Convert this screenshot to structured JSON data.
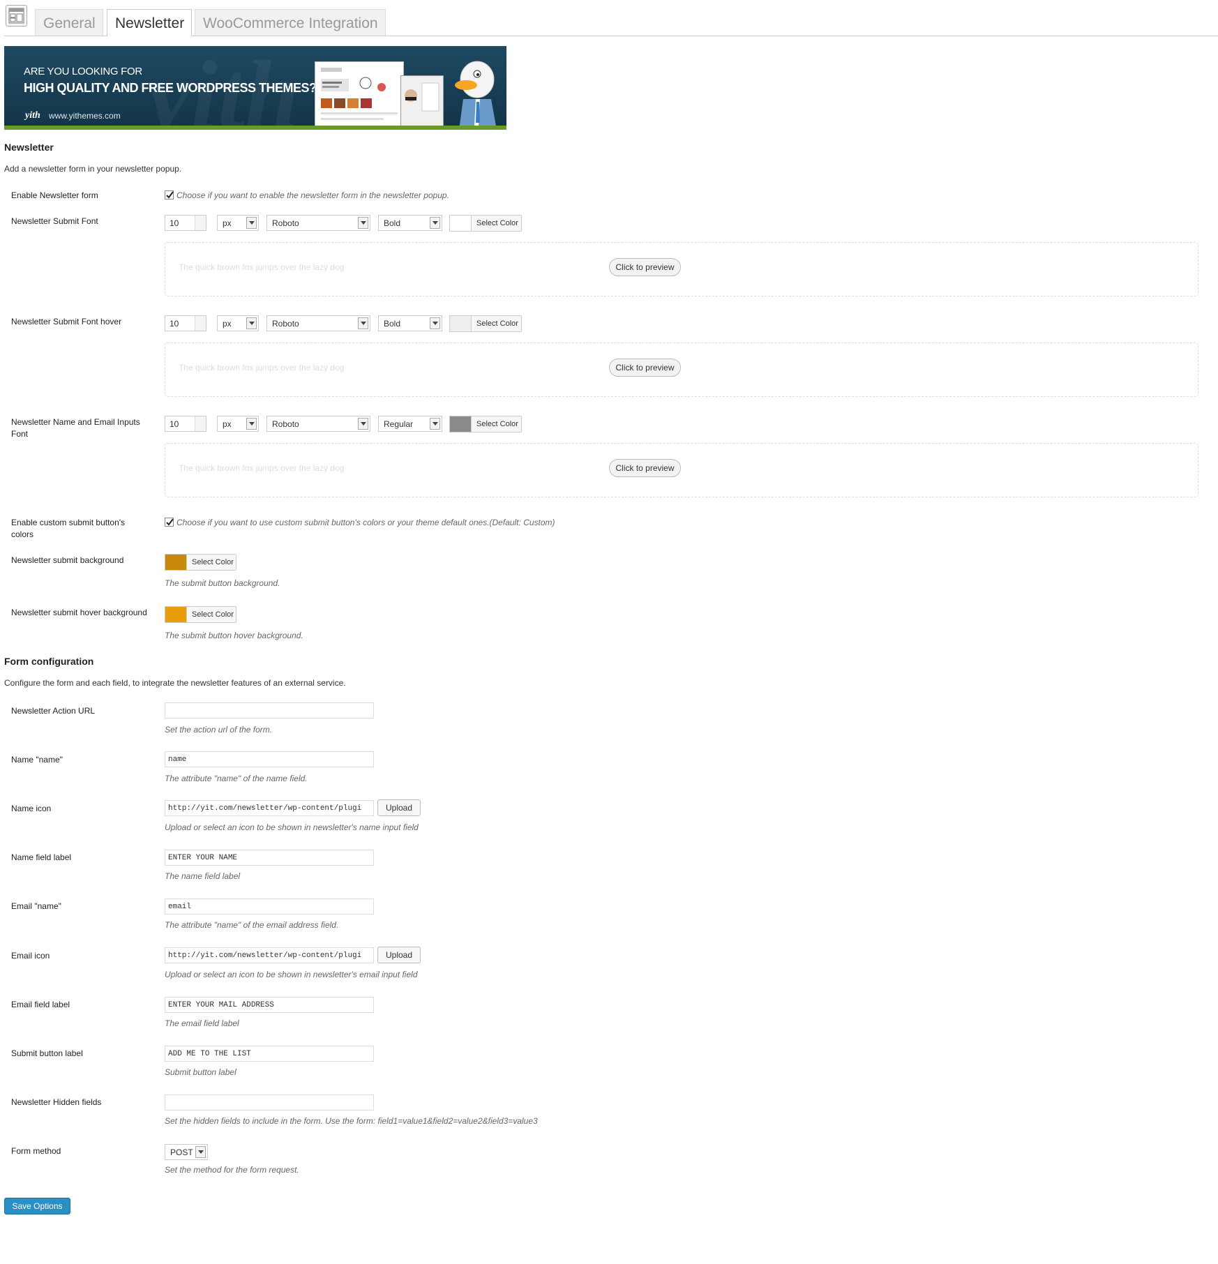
{
  "tabs": [
    {
      "label": "General",
      "active": false
    },
    {
      "label": "Newsletter",
      "active": true
    },
    {
      "label": "WooCommerce Integration",
      "active": false
    }
  ],
  "banner": {
    "line1": "ARE YOU LOOKING FOR",
    "line2": "HIGH QUALITY AND FREE WORDPRESS THEMES?",
    "logo": "yith",
    "url": "www.yithemes.com"
  },
  "newsletter": {
    "title": "Newsletter",
    "description": "Add a newsletter form in your newsletter popup.",
    "enable": {
      "label": "Enable Newsletter form",
      "checked": true,
      "hint": "Choose if you want to enable the newsletter form in the newsletter popup."
    },
    "fonts": [
      {
        "label": "Newsletter Submit Font",
        "size": "10",
        "unit": "px",
        "family": "Roboto",
        "style": "Bold",
        "swatch": "#ffffff",
        "color_label": "Select Color",
        "preview_text": "The quick brown fox jumps over the lazy dog",
        "preview_button": "Click to preview"
      },
      {
        "label": "Newsletter Submit Font hover",
        "size": "10",
        "unit": "px",
        "family": "Roboto",
        "style": "Bold",
        "swatch": "#eeeeee",
        "color_label": "Select Color",
        "preview_text": "The quick brown fox jumps over the lazy dog",
        "preview_button": "Click to preview"
      },
      {
        "label": "Newsletter Name and Email Inputs Font",
        "size": "10",
        "unit": "px",
        "family": "Roboto",
        "style": "Regular",
        "swatch": "#8a8a8a",
        "color_label": "Select Color",
        "preview_text": "The quick brown fox jumps over the lazy dog",
        "preview_button": "Click to preview"
      }
    ],
    "custom_colors": {
      "label": "Enable custom submit button's colors",
      "checked": true,
      "hint": "Choose if you want to use custom submit button's colors or your theme default ones.(Default: Custom)"
    },
    "submit_bg": {
      "label": "Newsletter submit background",
      "swatch": "#c8880a",
      "color_label": "Select Color",
      "hint": "The submit button background."
    },
    "submit_hover_bg": {
      "label": "Newsletter submit hover background",
      "swatch": "#e89d0b",
      "color_label": "Select Color",
      "hint": "The submit button hover background."
    }
  },
  "form_config": {
    "title": "Form configuration",
    "description": "Configure the form and each field, to integrate the newsletter features of an external service.",
    "fields": [
      {
        "label": "Newsletter Action URL",
        "value": "",
        "hint": "Set the action url of the form.",
        "upload": ""
      },
      {
        "label": "Name \"name\"",
        "value": "name",
        "hint": "The attribute \"name\" of the name field.",
        "upload": ""
      },
      {
        "label": "Name icon",
        "value": "http://yit.com/newsletter/wp-content/plugi",
        "hint": "Upload or select an icon to be shown in newsletter's name input field",
        "upload": "Upload"
      },
      {
        "label": "Name field label",
        "value": "ENTER YOUR NAME",
        "hint": "The name field label",
        "upload": ""
      },
      {
        "label": "Email \"name\"",
        "value": "email",
        "hint": "The attribute \"name\" of the email address field.",
        "upload": ""
      },
      {
        "label": "Email icon",
        "value": "http://yit.com/newsletter/wp-content/plugi",
        "hint": "Upload or select an icon to be shown in newsletter's email input field",
        "upload": "Upload"
      },
      {
        "label": "Email field label",
        "value": "ENTER YOUR MAIL ADDRESS",
        "hint": "The email field label",
        "upload": ""
      },
      {
        "label": "Submit button label",
        "value": "ADD ME TO THE LIST",
        "hint": "Submit button label",
        "upload": ""
      },
      {
        "label": "Newsletter Hidden fields",
        "value": "",
        "hint": "Set the hidden fields to include in the form. Use the form: field1=value1&field2=value2&field3=value3",
        "upload": ""
      }
    ],
    "method": {
      "label": "Form method",
      "value": "POST",
      "hint": "Set the method for the form request."
    }
  },
  "save_label": "Save Options"
}
